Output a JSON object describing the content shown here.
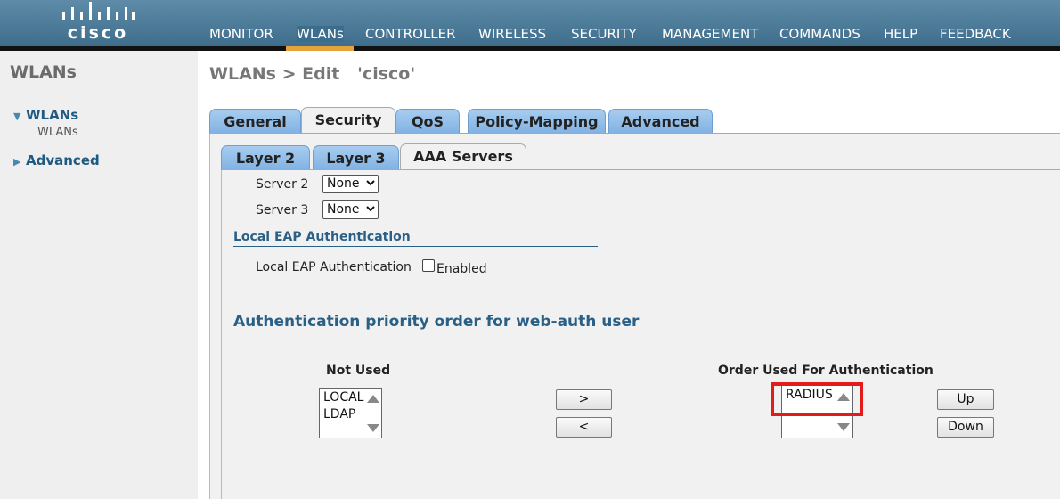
{
  "brand": {
    "logo_text": "cisco"
  },
  "topnav": {
    "items": [
      {
        "label": "MONITOR"
      },
      {
        "label": "WLANs"
      },
      {
        "label": "CONTROLLER"
      },
      {
        "label": "WIRELESS"
      },
      {
        "label": "SECURITY"
      },
      {
        "label": "MANAGEMENT"
      },
      {
        "label": "COMMANDS"
      },
      {
        "label": "HELP"
      },
      {
        "label": "FEEDBACK"
      }
    ],
    "active": "WLANs"
  },
  "sidebar": {
    "title": "WLANs",
    "items": [
      {
        "label": "WLANs",
        "expanded": true,
        "children": [
          {
            "label": "WLANs"
          }
        ]
      },
      {
        "label": "Advanced",
        "expanded": false
      }
    ]
  },
  "page": {
    "title": "WLANs > Edit   'cisco'"
  },
  "tabs": {
    "items": [
      {
        "label": "General"
      },
      {
        "label": "Security"
      },
      {
        "label": "QoS"
      },
      {
        "label": "Policy-Mapping"
      },
      {
        "label": "Advanced"
      }
    ],
    "active": "Security"
  },
  "subtabs": {
    "items": [
      {
        "label": "Layer 2"
      },
      {
        "label": "Layer 3"
      },
      {
        "label": "AAA Servers"
      }
    ],
    "active": "AAA Servers"
  },
  "servers": [
    {
      "label": "Server 2",
      "value": "None"
    },
    {
      "label": "Server 3",
      "value": "None"
    }
  ],
  "local_eap": {
    "heading": "Local EAP Authentication",
    "label": "Local EAP Authentication",
    "checkbox_label": "Enabled",
    "checked": false
  },
  "priority": {
    "heading": "Authentication priority order for web-auth user",
    "not_used": {
      "label": "Not Used",
      "options": [
        "LOCAL",
        "LDAP"
      ]
    },
    "move_right_label": ">",
    "move_left_label": "<",
    "used": {
      "label": "Order Used For Authentication",
      "options": [
        "RADIUS"
      ]
    },
    "up_label": "Up",
    "down_label": "Down"
  },
  "colors": {
    "header_bg": "#4a7b9b",
    "active_underline": "#e6a33c",
    "tab_bg": "#8fbbe8",
    "section_heading": "#2a5f86",
    "highlight": "#e31b1b"
  }
}
